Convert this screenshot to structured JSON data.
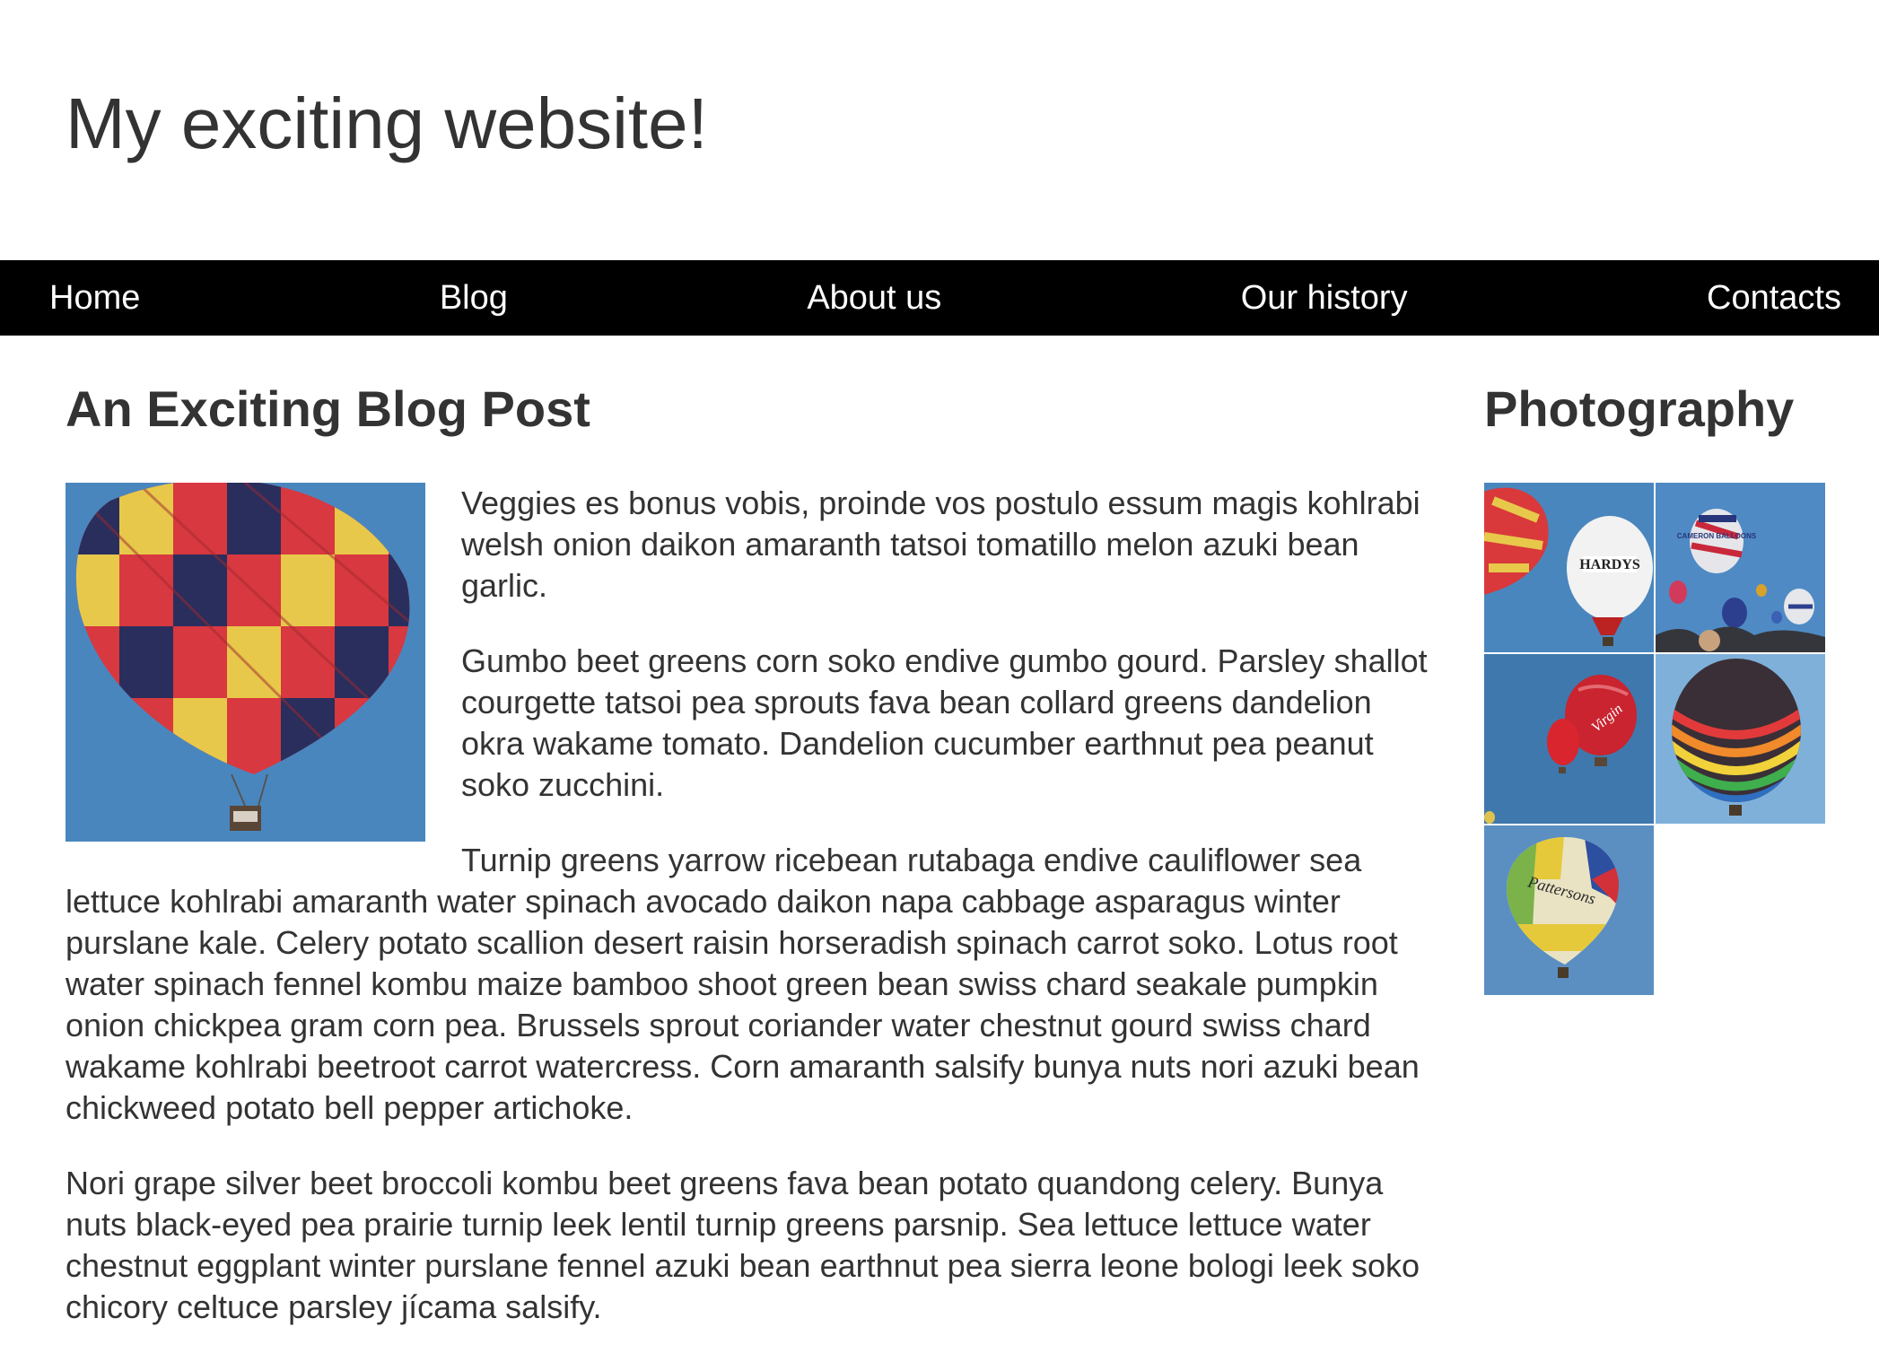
{
  "site": {
    "title": "My exciting website!"
  },
  "nav": {
    "items": [
      {
        "label": "Home"
      },
      {
        "label": "Blog"
      },
      {
        "label": "About us"
      },
      {
        "label": "Our history"
      },
      {
        "label": "Contacts"
      }
    ]
  },
  "post": {
    "title": "An Exciting Blog Post",
    "image": {
      "icon": "hot-air-balloon-photo"
    },
    "paragraphs": [
      "Veggies es bonus vobis, proinde vos postulo essum magis kohlrabi welsh onion daikon amaranth tatsoi tomatillo melon azuki bean garlic.",
      "Gumbo beet greens corn soko endive gumbo gourd. Parsley shallot courgette tatsoi pea sprouts fava bean collard greens dandelion okra wakame tomato. Dandelion cucumber earthnut pea peanut soko zucchini.",
      "Turnip greens yarrow ricebean rutabaga endive cauliflower sea lettuce kohlrabi amaranth water spinach avocado daikon napa cabbage asparagus winter purslane kale. Celery potato scallion desert raisin horseradish spinach carrot soko. Lotus root water spinach fennel kombu maize bamboo shoot green bean swiss chard seakale pumpkin onion chickpea gram corn pea. Brussels sprout coriander water chestnut gourd swiss chard wakame kohlrabi beetroot carrot watercress. Corn amaranth salsify bunya nuts nori azuki bean chickweed potato bell pepper artichoke.",
      "Nori grape silver beet broccoli kombu beet greens fava bean potato quandong celery. Bunya nuts black-eyed pea prairie turnip leek lentil turnip greens parsnip. Sea lettuce lettuce water chestnut eggplant winter purslane fennel azuki bean earthnut pea sierra leone bologi leek soko chicory celtuce parsley jícama salsify."
    ]
  },
  "sidebar": {
    "title": "Photography",
    "photos": [
      {
        "icon": "balloon-photo",
        "label": "HARDYS"
      },
      {
        "icon": "balloon-photo",
        "label": "CAMERON BALLOONS"
      },
      {
        "icon": "balloon-photo",
        "label": "Virgin"
      },
      {
        "icon": "balloon-photo"
      },
      {
        "icon": "balloon-photo",
        "label": "Pattersons"
      }
    ]
  },
  "colors": {
    "nav_background": "#000000",
    "nav_text": "#ffffff",
    "body_text": "#333333",
    "sky_blue": "#4a86be"
  }
}
